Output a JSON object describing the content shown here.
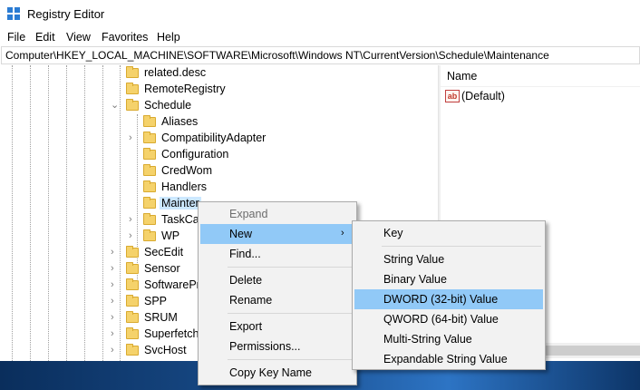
{
  "window": {
    "title": "Registry Editor"
  },
  "menu": [
    "File",
    "Edit",
    "View",
    "Favorites",
    "Help"
  ],
  "address": "Computer\\HKEY_LOCAL_MACHINE\\SOFTWARE\\Microsoft\\Windows NT\\CurrentVersion\\Schedule\\Maintenance",
  "tree": [
    {
      "label": "related.desc",
      "expander": ""
    },
    {
      "label": "RemoteRegistry",
      "expander": ""
    },
    {
      "label": "Schedule",
      "expander": "v"
    },
    {
      "label": "Aliases",
      "expander": ""
    },
    {
      "label": "CompatibilityAdapter",
      "expander": ">"
    },
    {
      "label": "Configuration",
      "expander": ""
    },
    {
      "label": "CredWom",
      "expander": ""
    },
    {
      "label": "Handlers",
      "expander": ""
    },
    {
      "label": "Mainter",
      "expander": "",
      "selected": true
    },
    {
      "label": "TaskCac",
      "expander": ">"
    },
    {
      "label": "WP",
      "expander": ">"
    },
    {
      "label": "SecEdit",
      "expander": ">"
    },
    {
      "label": "Sensor",
      "expander": ">"
    },
    {
      "label": "SoftwarePro",
      "expander": ">"
    },
    {
      "label": "SPP",
      "expander": ">"
    },
    {
      "label": "SRUM",
      "expander": ">"
    },
    {
      "label": "Superfetch",
      "expander": ">"
    },
    {
      "label": "SvcHost",
      "expander": ">"
    }
  ],
  "right_pane": {
    "column_name": "Name",
    "values": [
      {
        "name": "(Default)",
        "icon": "string-value-icon"
      }
    ]
  },
  "context_menu": {
    "items": [
      "Expand",
      "New",
      "Find...",
      "Delete",
      "Rename",
      "Export",
      "Permissions...",
      "Copy Key Name"
    ],
    "submenu_arrow": "›"
  },
  "new_submenu": {
    "items": [
      "Key",
      "String Value",
      "Binary Value",
      "DWORD (32-bit) Value",
      "QWORD (64-bit) Value",
      "Multi-String Value",
      "Expandable String Value"
    ]
  },
  "colors": {
    "highlight": "#91c9f7",
    "selection": "#cce8ff",
    "folder": "#f5d26b"
  }
}
